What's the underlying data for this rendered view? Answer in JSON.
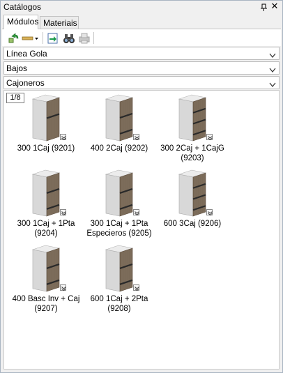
{
  "window": {
    "title": "Catálogos"
  },
  "tabs": [
    {
      "label": "Módulos",
      "active": true
    },
    {
      "label": "Materiais",
      "active": false
    }
  ],
  "toolbar": {
    "icons": [
      "refresh-green-icon",
      "ruler-dropdown-icon",
      "insert-arrow-icon",
      "binoculars-icon",
      "print-disabled-icon"
    ]
  },
  "filters": {
    "line": "Línea Gola",
    "category": "Bajos",
    "subcategory": "Cajoneros"
  },
  "content": {
    "page_indicator": "1/8",
    "items": [
      {
        "label_line1": "300 1Caj (9201)",
        "label_line2": "",
        "drawers": 1,
        "doors": 0
      },
      {
        "label_line1": "400 2Caj (9202)",
        "label_line2": "",
        "drawers": 2,
        "doors": 0
      },
      {
        "label_line1": "300 2Caj + 1CajG",
        "label_line2": "(9203)",
        "drawers": 3,
        "doors": 0
      },
      {
        "label_line1": "300 1Caj + 1Pta",
        "label_line2": "(9204)",
        "drawers": 1,
        "doors": 1
      },
      {
        "label_line1": "300 1Caj + 1Pta",
        "label_line2": "Especieros (9205)",
        "drawers": 1,
        "doors": 1
      },
      {
        "label_line1": "600 3Caj (9206)",
        "label_line2": "",
        "drawers": 3,
        "doors": 0
      },
      {
        "label_line1": "400 Basc Inv + Caj",
        "label_line2": "(9207)",
        "drawers": 1,
        "doors": 1
      },
      {
        "label_line1": "600 1Caj + 2Pta",
        "label_line2": "(9208)",
        "drawers": 1,
        "doors": 1
      }
    ]
  },
  "colors": {
    "wood": "#7a6a58",
    "carcass": "#d8d8d8",
    "handle": "#2a2a2a",
    "accent_green": "#2e9a3a"
  }
}
